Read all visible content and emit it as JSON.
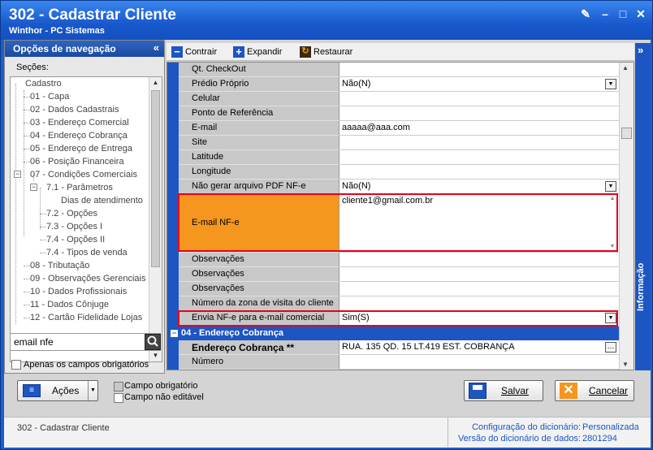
{
  "window": {
    "title": "302 - Cadastrar Cliente",
    "subtitle": "Winthor - PC Sistemas"
  },
  "nav": {
    "header": "Opções de navegação",
    "sections_label": "Seções:",
    "tree": [
      {
        "label": "Cadastro"
      },
      {
        "label": "01 - Capa"
      },
      {
        "label": "02 - Dados Cadastrais"
      },
      {
        "label": "03 - Endereço Comercial"
      },
      {
        "label": "04 - Endereço Cobrança"
      },
      {
        "label": "05 - Endereço de Entrega"
      },
      {
        "label": "06 - Posição Financeira"
      },
      {
        "label": "07 - Condições Comerciais"
      },
      {
        "label": "7.1 - Parâmetros"
      },
      {
        "label": "Dias de atendimento"
      },
      {
        "label": "7.2 - Opções"
      },
      {
        "label": "7.3 - Opções I"
      },
      {
        "label": "7.4 - Opções II"
      },
      {
        "label": "7.4 - Tipos de venda"
      },
      {
        "label": "08 - Tributação"
      },
      {
        "label": "09 - Observações Gerenciais"
      },
      {
        "label": "10 - Dados Profissionais"
      },
      {
        "label": "11 - Dados Cônjuge"
      },
      {
        "label": "12 - Cartão Fidelidade Lojas"
      }
    ],
    "search_value": "email nfe",
    "only_required_label": "Apenas os campos obrigatórios"
  },
  "toolbar": {
    "contrair": "Contrair",
    "expandir": "Expandir",
    "restaurar": "Restaurar"
  },
  "grid": {
    "rows": [
      {
        "label": "Qt. CheckOut",
        "value": ""
      },
      {
        "label": "Prédio Próprio",
        "value": "Não(N)"
      },
      {
        "label": "Celular",
        "value": ""
      },
      {
        "label": "Ponto de Referência",
        "value": ""
      },
      {
        "label": "E-mail",
        "value": "aaaaa@aaa.com"
      },
      {
        "label": "Site",
        "value": ""
      },
      {
        "label": "Latitude",
        "value": ""
      },
      {
        "label": "Longitude",
        "value": ""
      },
      {
        "label": "Não gerar arquivo PDF NF-e",
        "value": "Não(N)"
      }
    ],
    "email_nfe_label": "E-mail NF-e",
    "email_nfe_value": "cliente1@gmail.com.br",
    "rows2": [
      {
        "label": "Observações",
        "value": ""
      },
      {
        "label": "Observações",
        "value": ""
      },
      {
        "label": "Observações",
        "value": ""
      },
      {
        "label": "Número da zona de visita do cliente",
        "value": ""
      }
    ],
    "envia_label": "Envia NF-e para e-mail comercial",
    "envia_value": "Sim(S)",
    "group_label": "04 - Endereço Cobrança",
    "endereco_label": "Endereço Cobrança **",
    "endereco_value": "RUA. 135 QD. 15 LT.419 EST. COBRANÇA",
    "numero_label": "Número"
  },
  "side_info": "Informação",
  "bottom": {
    "acoes": "Ações",
    "legend_required": "Campo obrigatório",
    "legend_readonly": "Campo não editável",
    "salvar": "Salvar",
    "cancelar": "Cancelar"
  },
  "status": {
    "left": "302 - Cadastrar Cliente",
    "config_label": "Configuração do dicionário:",
    "config_value": "Personalizada",
    "version_label": "Versão do dicionário de dados:",
    "version_value": "2801294"
  },
  "colors": {
    "accent_blue": "#1d56c2",
    "highlight_red": "#e8001c",
    "selected_orange": "#f5961e"
  }
}
